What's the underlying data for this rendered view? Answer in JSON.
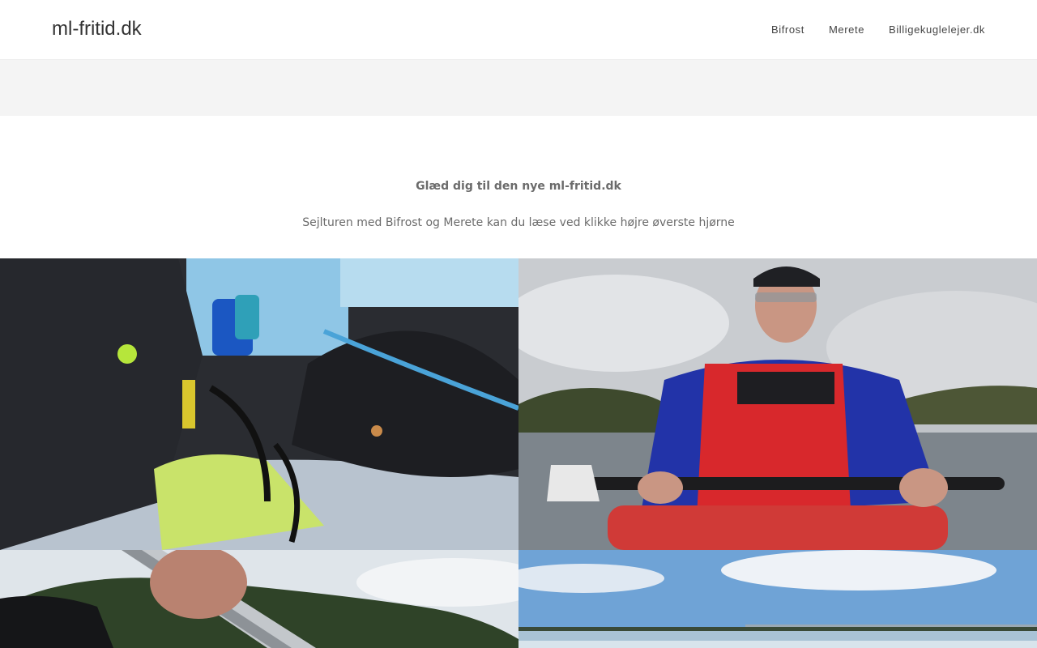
{
  "site": {
    "title": "ml-fritid.dk"
  },
  "nav": {
    "items": [
      {
        "label": "Bifrost"
      },
      {
        "label": "Merete"
      },
      {
        "label": "Billigekuglelejer.dk"
      }
    ]
  },
  "intro": {
    "heading": "Glæd dig til den nye ml-fritid.dk",
    "text": "Sejlturen med Bifrost og Merete kan du læse ved klikke højre øverste hjørne"
  },
  "gallery": {
    "images": [
      {
        "subject": "divers-in-boat-photo"
      },
      {
        "subject": "kayaker-portrait-photo"
      },
      {
        "subject": "paddle-hand-photo"
      },
      {
        "subject": "bridge-over-water-photo"
      }
    ]
  },
  "colors": {
    "header_bg": "#ffffff",
    "banner_bg": "#f4f4f4",
    "text_muted": "#6b6b6b",
    "title": "#333333"
  }
}
